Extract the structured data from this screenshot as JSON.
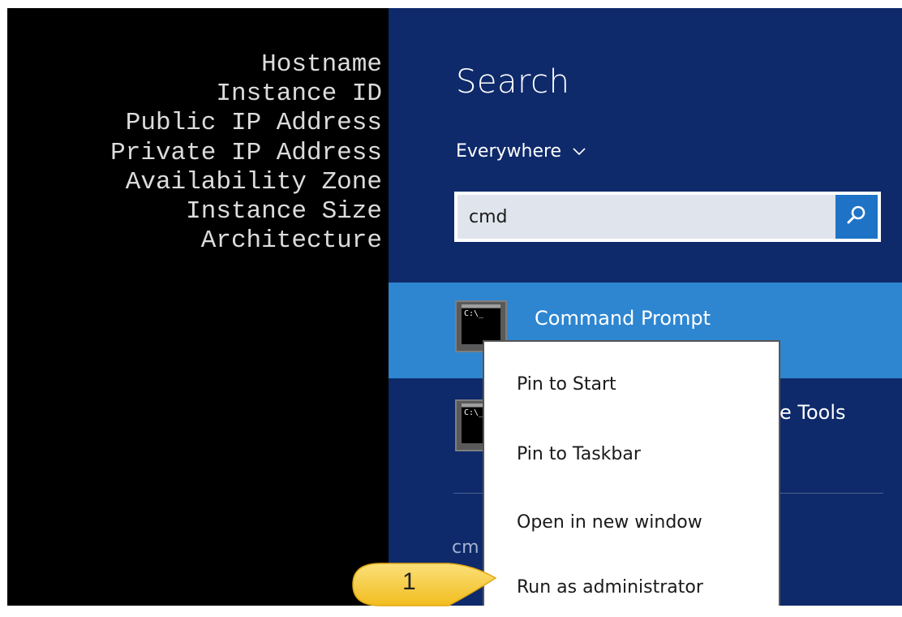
{
  "desktop_info": {
    "lines": [
      "Hostname",
      "Instance ID",
      "Public IP Address",
      "Private IP Address",
      "Availability Zone",
      "Instance Size",
      "Architecture"
    ]
  },
  "search": {
    "title": "Search",
    "scope": "Everywhere",
    "query": "cmd",
    "results": [
      {
        "label": "Command Prompt",
        "icon": "cmd-icon",
        "selected": true
      },
      {
        "label": "e Tools",
        "icon": "cmd-icon",
        "selected": false
      }
    ],
    "partial_label": "cm"
  },
  "context_menu": {
    "items": [
      "Pin to Start",
      "Pin to Taskbar",
      "Open in new window",
      "Run as administrator"
    ]
  },
  "callout": {
    "number": "1",
    "color": "#f7c934"
  },
  "colors": {
    "charm_bg": "#0e2a6b",
    "selected_bg": "#2e86d1",
    "search_button": "#1e73c6"
  },
  "icons": {
    "scope_chevron": "chevron-down-icon",
    "search_button": "search-icon"
  }
}
